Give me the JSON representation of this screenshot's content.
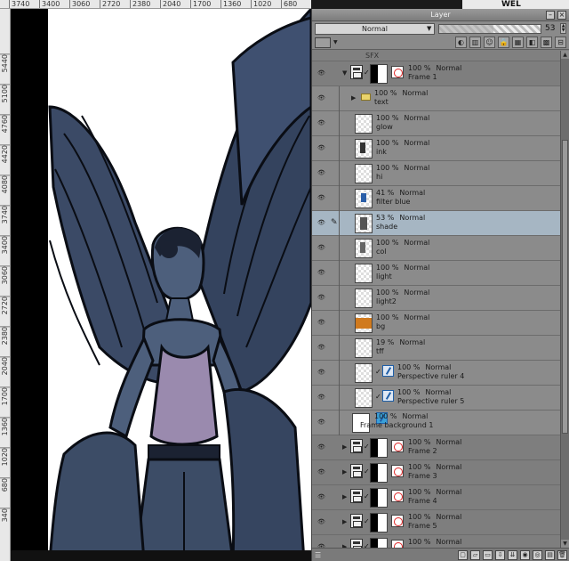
{
  "ruler_top": [
    "3740",
    "3400",
    "3060",
    "2720",
    "2380",
    "2040",
    "1700",
    "1360",
    "1020",
    "680"
  ],
  "ruler_left": [
    "5440",
    "5100",
    "4760",
    "4420",
    "4080",
    "3740",
    "3400",
    "3060",
    "2720",
    "2380",
    "2040",
    "1700",
    "1360",
    "1020",
    "680",
    "340"
  ],
  "behind_text": "WEL",
  "panel": {
    "title": "Layer",
    "close_glyph": "×",
    "min_glyph": "–",
    "blend_mode": "Normal",
    "opacity": "53",
    "opacity_fraction": 0.53
  },
  "layers": {
    "partial_top": "SFX",
    "rows": [
      {
        "kind": "folder-frame",
        "pct": "100 %",
        "mode": "Normal",
        "name": "Frame 1",
        "expanded": true
      },
      {
        "kind": "folder",
        "pct": "100 %",
        "mode": "Normal",
        "name": "text"
      },
      {
        "kind": "raster",
        "pct": "100 %",
        "mode": "Normal",
        "name": "glow"
      },
      {
        "kind": "raster",
        "pct": "100 %",
        "mode": "Normal",
        "name": "ink"
      },
      {
        "kind": "raster",
        "pct": "100 %",
        "mode": "Normal",
        "name": "hi"
      },
      {
        "kind": "raster",
        "pct": "41 %",
        "mode": "Normal",
        "name": "filter blue"
      },
      {
        "kind": "raster",
        "pct": "53 %",
        "mode": "Normal",
        "name": "shade",
        "selected": true
      },
      {
        "kind": "raster",
        "pct": "100 %",
        "mode": "Normal",
        "name": "col"
      },
      {
        "kind": "raster",
        "pct": "100 %",
        "mode": "Normal",
        "name": "light"
      },
      {
        "kind": "raster",
        "pct": "100 %",
        "mode": "Normal",
        "name": "light2"
      },
      {
        "kind": "raster",
        "pct": "100 %",
        "mode": "Normal",
        "name": "bg"
      },
      {
        "kind": "raster",
        "pct": "19 %",
        "mode": "Normal",
        "name": "tff"
      },
      {
        "kind": "ruler",
        "pct": "100 %",
        "mode": "Normal",
        "name": "Perspective ruler 4"
      },
      {
        "kind": "ruler",
        "pct": "100 %",
        "mode": "Normal",
        "name": "Perspective ruler 5"
      },
      {
        "kind": "background",
        "pct": "100 %",
        "mode": "Normal",
        "name": "Frame background 1"
      },
      {
        "kind": "folder-frame",
        "pct": "100 %",
        "mode": "Normal",
        "name": "Frame 2"
      },
      {
        "kind": "folder-frame",
        "pct": "100 %",
        "mode": "Normal",
        "name": "Frame 3"
      },
      {
        "kind": "folder-frame",
        "pct": "100 %",
        "mode": "Normal",
        "name": "Frame 4"
      },
      {
        "kind": "folder-frame",
        "pct": "100 %",
        "mode": "Normal",
        "name": "Frame 5"
      },
      {
        "kind": "folder-frame",
        "pct": "100 %",
        "mode": "Normal",
        "name": ""
      }
    ]
  },
  "colors": {
    "panel_bg": "#808080",
    "selected_row": "#a6b6c3",
    "figure_blue": "#3c4c66",
    "shirt_purple": "#9a8aae"
  }
}
